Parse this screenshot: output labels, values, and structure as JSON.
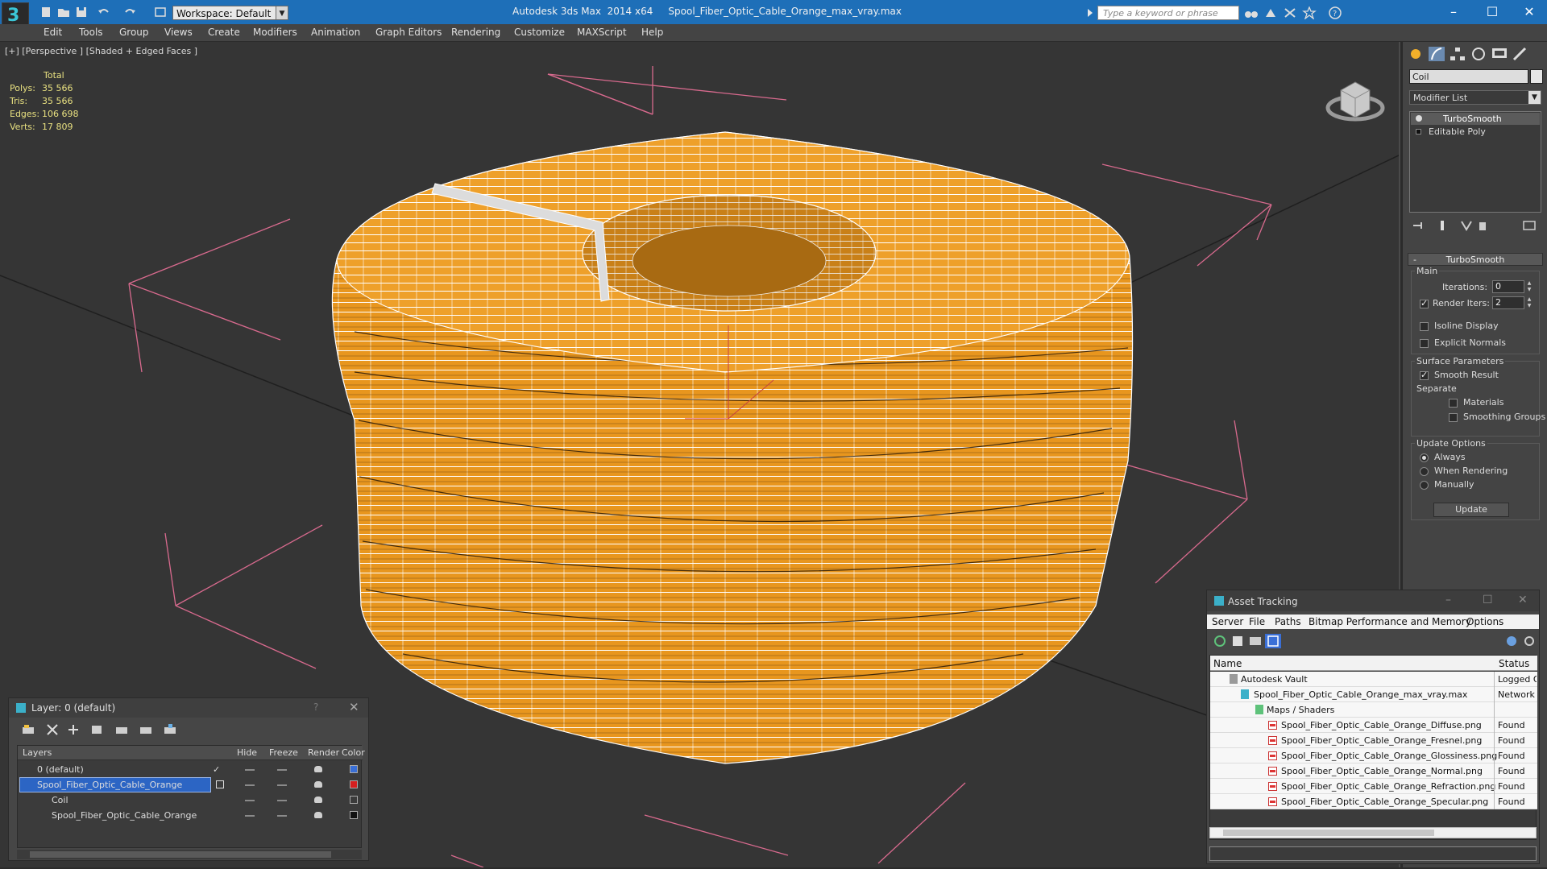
{
  "app": {
    "logo_text": "3",
    "workspace_label": "Workspace: Default",
    "window_title": "Autodesk 3ds Max  2014 x64     Spool_Fiber_Optic_Cable_Orange_max_vray.max",
    "search_placeholder": "Type a keyword or phrase",
    "accent_color": "#1e6fb8"
  },
  "menu": [
    "Edit",
    "Tools",
    "Group",
    "Views",
    "Create",
    "Modifiers",
    "Animation",
    "Graph Editors",
    "Rendering",
    "Customize",
    "MAXScript",
    "Help"
  ],
  "viewport": {
    "label": "[+] [Perspective ] [Shaded + Edged Faces ]",
    "stats": {
      "header": "Total",
      "rows": [
        {
          "key": "Polys:",
          "value": "35 566"
        },
        {
          "key": "Tris:",
          "value": "35 566"
        },
        {
          "key": "Edges:",
          "value": "106 698"
        },
        {
          "key": "Verts:",
          "value": "17 809"
        }
      ]
    },
    "object_color": "#e8961e"
  },
  "command_panel": {
    "object_name": "Coil",
    "modifier_list": "Modifier List",
    "stack": [
      "TurboSmooth",
      "Editable Poly"
    ],
    "turbosmooth": {
      "title": "TurboSmooth",
      "main_label": "Main",
      "iterations_label": "Iterations:",
      "iterations_value": "0",
      "render_iters_label": "Render Iters:",
      "render_iters_value": "2",
      "render_iters_checked": true,
      "isoline_label": "Isoline Display",
      "explicit_normals_label": "Explicit Normals",
      "surface_params_label": "Surface Parameters",
      "smooth_result_label": "Smooth Result",
      "separate_label": "Separate",
      "materials_label": "Materials",
      "smoothing_groups_label": "Smoothing Groups",
      "update_options_label": "Update Options",
      "always_label": "Always",
      "when_rendering_label": "When Rendering",
      "manually_label": "Manually",
      "update_button": "Update"
    }
  },
  "layer_panel": {
    "title": "Layer: 0 (default)",
    "help": "?",
    "columns": {
      "layers": "Layers",
      "hide": "Hide",
      "freeze": "Freeze",
      "render": "Render",
      "color": "Color"
    },
    "rows": [
      {
        "name": "0 (default)",
        "color": "#3a6fd6"
      },
      {
        "name": "Spool_Fiber_Optic_Cable_Orange",
        "color": "#d41f1f"
      },
      {
        "name": "Coil",
        "color": "#3b3b3b"
      },
      {
        "name": "Spool_Fiber_Optic_Cable_Orange",
        "color": "#111111"
      }
    ]
  },
  "asset_tracking": {
    "title": "Asset Tracking",
    "menu": [
      "Server",
      "File",
      "Paths",
      "Bitmap Performance and Memory",
      "Options"
    ],
    "columns": {
      "name": "Name",
      "status": "Status"
    },
    "rows": [
      {
        "name": "Autodesk Vault",
        "status": "Logged O"
      },
      {
        "name": "Spool_Fiber_Optic_Cable_Orange_max_vray.max",
        "status": "Network F"
      },
      {
        "name": "Maps / Shaders",
        "status": ""
      },
      {
        "name": "Spool_Fiber_Optic_Cable_Orange_Diffuse.png",
        "status": "Found"
      },
      {
        "name": "Spool_Fiber_Optic_Cable_Orange_Fresnel.png",
        "status": "Found"
      },
      {
        "name": "Spool_Fiber_Optic_Cable_Orange_Glossiness.png",
        "status": "Found"
      },
      {
        "name": "Spool_Fiber_Optic_Cable_Orange_Normal.png",
        "status": "Found"
      },
      {
        "name": "Spool_Fiber_Optic_Cable_Orange_Refraction.png",
        "status": "Found"
      },
      {
        "name": "Spool_Fiber_Optic_Cable_Orange_Specular.png",
        "status": "Found"
      }
    ]
  }
}
